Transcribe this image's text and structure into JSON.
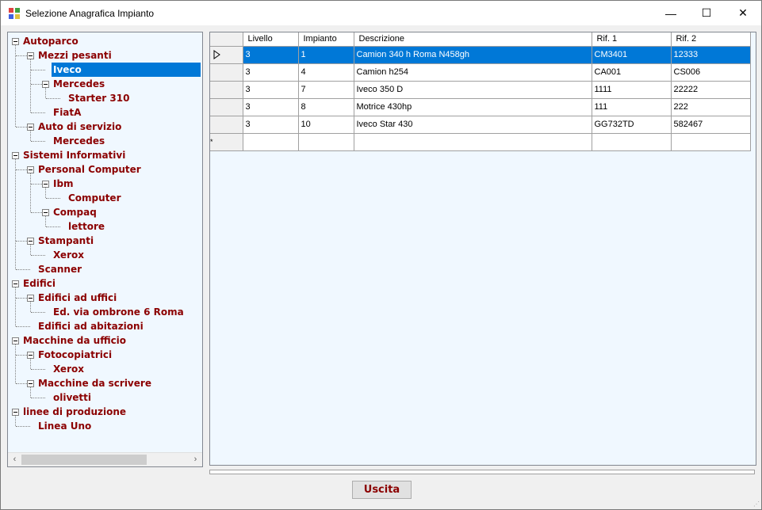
{
  "window": {
    "title": "Selezione Anagrafica Impianto",
    "controls": {
      "minimize": "—",
      "maximize": "☐",
      "close": "✕"
    }
  },
  "tree": {
    "nodes": [
      {
        "label": "Autoparco",
        "level": 0,
        "expanded": true
      },
      {
        "label": "Mezzi pesanti",
        "level": 1,
        "expanded": true
      },
      {
        "label": "Iveco",
        "level": 2,
        "selected": true
      },
      {
        "label": "Mercedes",
        "level": 2,
        "expanded": true
      },
      {
        "label": "Starter 310",
        "level": 3
      },
      {
        "label": "FiatA",
        "level": 2
      },
      {
        "label": "Auto di servizio",
        "level": 1,
        "expanded": true
      },
      {
        "label": "Mercedes",
        "level": 2
      },
      {
        "label": "Sistemi Informativi",
        "level": 0,
        "expanded": true
      },
      {
        "label": "Personal Computer",
        "level": 1,
        "expanded": true
      },
      {
        "label": "Ibm",
        "level": 2,
        "expanded": true
      },
      {
        "label": "Computer",
        "level": 3
      },
      {
        "label": "Compaq",
        "level": 2,
        "expanded": true
      },
      {
        "label": "lettore",
        "level": 3
      },
      {
        "label": "Stampanti",
        "level": 1,
        "expanded": true
      },
      {
        "label": "Xerox",
        "level": 2
      },
      {
        "label": "Scanner",
        "level": 1
      },
      {
        "label": "Edifici",
        "level": 0,
        "expanded": true
      },
      {
        "label": "Edifici ad uffici",
        "level": 1,
        "expanded": true
      },
      {
        "label": "Ed. via ombrone 6 Roma",
        "level": 2
      },
      {
        "label": "Edifici ad abitazioni",
        "level": 1
      },
      {
        "label": "Macchine da ufficio",
        "level": 0,
        "expanded": true
      },
      {
        "label": "Fotocopiatrici",
        "level": 1,
        "expanded": true
      },
      {
        "label": "Xerox",
        "level": 2
      },
      {
        "label": "Macchine da scrivere",
        "level": 1,
        "expanded": true
      },
      {
        "label": "olivetti",
        "level": 2
      },
      {
        "label": "linee di produzione",
        "level": 0,
        "expanded": true
      },
      {
        "label": "Linea Uno",
        "level": 1
      }
    ],
    "scroll_left": "‹",
    "scroll_right": "›"
  },
  "grid": {
    "columns": [
      "Livello",
      "Impianto",
      "Descrizione",
      "Rif. 1",
      "Rif. 2"
    ],
    "rows": [
      {
        "livello": "3",
        "impianto": "1",
        "descrizione": "Camion 340 h Roma N458gh",
        "rif1": "CM3401",
        "rif2": "12333",
        "selected": true
      },
      {
        "livello": "3",
        "impianto": "4",
        "descrizione": "Camion h254",
        "rif1": "CA001",
        "rif2": "CS006"
      },
      {
        "livello": "3",
        "impianto": "7",
        "descrizione": "Iveco 350 D",
        "rif1": "1111",
        "rif2": "22222"
      },
      {
        "livello": "3",
        "impianto": "8",
        "descrizione": "Motrice 430hp",
        "rif1": "111",
        "rif2": "222"
      },
      {
        "livello": "3",
        "impianto": "10",
        "descrizione": "Iveco Star 430",
        "rif1": "GG732TD",
        "rif2": "582467"
      }
    ],
    "new_row_marker": "*"
  },
  "buttons": {
    "exit": "Uscita"
  },
  "colors": {
    "tree_text": "#8b0000",
    "selection": "#0078d7",
    "panel_bg": "#f0f8ff"
  }
}
